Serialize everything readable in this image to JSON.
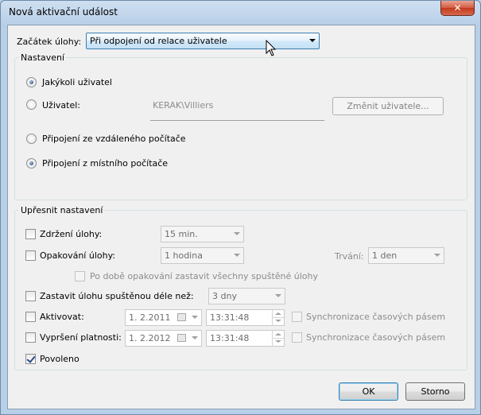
{
  "window": {
    "title": "Nová aktivační událost",
    "close_glyph": "✕"
  },
  "task_start": {
    "label": "Začátek úlohy:",
    "value": "Při odpojení od relace uživatele"
  },
  "settings": {
    "title": "Nastavení",
    "any_user": "Jakýkoli uživatel",
    "user": "Uživatel:",
    "user_value": "KERAK\\Villiers",
    "change_user": "Změnit uživatele...",
    "remote": "Připojení ze vzdáleného počítače",
    "local": "Připojení z místního počítače"
  },
  "advanced": {
    "title": "Upřesnit nastavení",
    "delay_label": "Zdržení úlohy:",
    "delay_value": "15 min.",
    "repeat_label": "Opakování úlohy:",
    "repeat_value": "1 hodina",
    "duration_label": "Trvání:",
    "duration_value": "1 den",
    "stop_all_label": "Po době opakování zastavit všechny spuštěné úlohy",
    "stop_longer_label": "Zastavit úlohu spuštěnou déle než:",
    "stop_longer_value": "3 dny",
    "activate_label": "Aktivovat:",
    "activate_date": "1.  2.2011",
    "activate_time": "13:31:48",
    "expire_label": "Vypršení platnosti:",
    "expire_date": "1.  2.2012",
    "expire_time": "13:31:48",
    "sync_label": "Synchronizace časových pásem",
    "enabled_label": "Povoleno"
  },
  "buttons": {
    "ok": "OK",
    "cancel": "Storno"
  }
}
